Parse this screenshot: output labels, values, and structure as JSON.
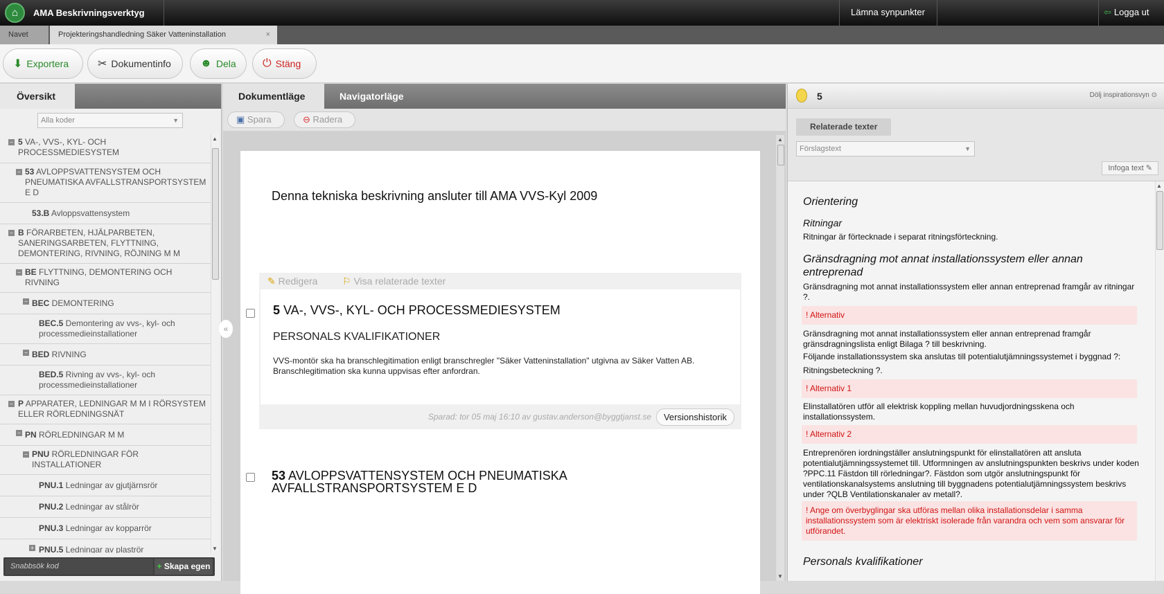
{
  "app": {
    "title": "AMA Beskrivningsverktyg",
    "feedback": "Lämna synpunkter",
    "logout": "Logga ut"
  },
  "tabs": {
    "navet": "Navet",
    "active": "Projekteringshandledning Säker Vatteninstallation",
    "close": "×"
  },
  "toolbar": {
    "export": "Exportera",
    "docinfo": "Dokumentinfo",
    "share": "Dela",
    "close": "Stäng"
  },
  "left": {
    "tab_overview": "Översikt",
    "filter": "Alla koder",
    "tree": [
      {
        "code": "5",
        "text": " VA-, VVS-, KYL- OCH PROCESSMEDIESYSTEM"
      },
      {
        "code": "53",
        "text": " AVLOPPSVATTENSYSTEM OCH PNEUMATISKA AVFALLSTRANSPORTSYSTEM E D"
      },
      {
        "code": "53.B",
        "text": " Avloppsvattensystem"
      },
      {
        "code": "B",
        "text": " FÖRARBETEN, HJÄLPARBETEN, SANERINGSARBETEN, FLYTTNING, DEMONTERING, RIVNING, RÖJNING M M"
      },
      {
        "code": "BE",
        "text": " FLYTTNING, DEMONTERING OCH RIVNING"
      },
      {
        "code": "BEC",
        "text": " DEMONTERING"
      },
      {
        "code": "BEC.5",
        "text": " Demontering av vvs-, kyl- och processmedieinstallationer"
      },
      {
        "code": "BED",
        "text": " RIVNING"
      },
      {
        "code": "BED.5",
        "text": " Rivning av vvs-, kyl- och processmedieinstallationer"
      },
      {
        "code": "P",
        "text": " APPARATER, LEDNINGAR M M I RÖRSYSTEM ELLER RÖRLEDNINGSNÄT"
      },
      {
        "code": "PN",
        "text": " RÖRLEDNINGAR M M"
      },
      {
        "code": "PNU",
        "text": " RÖRLEDNINGAR FÖR INSTALLATIONER"
      },
      {
        "code": "PNU.1",
        "text": " Ledningar av gjutjärnsrör"
      },
      {
        "code": "PNU.2",
        "text": " Ledningar av stålrör"
      },
      {
        "code": "PNU.3",
        "text": " Ledningar av kopparrör"
      },
      {
        "code": "PNU.5",
        "text": " Ledningar av plaströr"
      }
    ],
    "quick_placeholder": "Snabbsök kod",
    "create": "Skapa egen"
  },
  "mid": {
    "tab_doc": "Dokumentläge",
    "tab_nav": "Navigatorläge",
    "save": "Spara",
    "delete": "Radera",
    "doc_title": "Denna tekniska beskrivning ansluter till AMA VVS-Kyl 2009",
    "edit": "Redigera",
    "show_related": "Visa relaterade texter",
    "sec1": {
      "code": "5",
      "title": " VA-, VVS-, KYL- OCH PROCESSMEDIESYSTEM",
      "subtitle": "PERSONALS KVALIFIKATIONER",
      "text": "VVS-montör ska ha branschlegitimation enligt branschregler \"Säker Vatteninstallation\" utgivna av Säker Vatten AB. Branschlegitimation ska kunna uppvisas efter anfordran.",
      "saved": "Sparad: tor 05 maj 16:10 av gustav.anderson@byggtjanst.se",
      "history": "Versionshistorik"
    },
    "sec2": {
      "code": "53",
      "title": " AVLOPPSVATTENSYSTEM OCH PNEUMATISKA AVFALLSTRANSPORTSYSTEM E D"
    }
  },
  "right": {
    "num": "5",
    "hide": "Dölj inspirationsvyn",
    "tab": "Relaterade texter",
    "select": "Förslagstext",
    "insert": "Infoga text",
    "c": [
      "Orientering",
      "Ritningar",
      "Ritningar är förtecknade i separat ritningsförteckning.",
      "Gränsdragning mot annat installationssystem eller annan entreprenad",
      "Gränsdragning mot annat installationssystem eller annan entreprenad framgår av ritningar ?.",
      "! Alternativ",
      "Gränsdragning mot annat installationssystem eller annan entreprenad framgår gränsdragningslista enligt Bilaga ? till beskrivning.",
      "Följande installationssystem ska anslutas till potentialutjämningssystemet i byggnad ?:",
      "Ritningsbeteckning ?.",
      "! Alternativ 1",
      "Elinstallatören utför all elektrisk koppling mellan huvudjordningsskena och installationssystem.",
      "! Alternativ 2",
      "Entreprenören iordningställer anslutningspunkt för elinstallatören att ansluta potentialutjämningssystemet till. Utformningen av anslutningspunkten beskrivs under koden ?PPC.11 Fästdon till rörledningar?. Fästdon som utgör anslutningspunkt för ventilationskanalsystems anslutning till byggnadens potentialutjämningssystem beskrivs under ?QLB Ventilationskanaler av metall?.",
      "! Ange om överbyglingar ska utföras mellan olika installationsdelar i samma installationssystem som är elektriskt isolerade från varandra och vem som ansvarar för utförandet.",
      "Personals kvalifikationer"
    ]
  }
}
